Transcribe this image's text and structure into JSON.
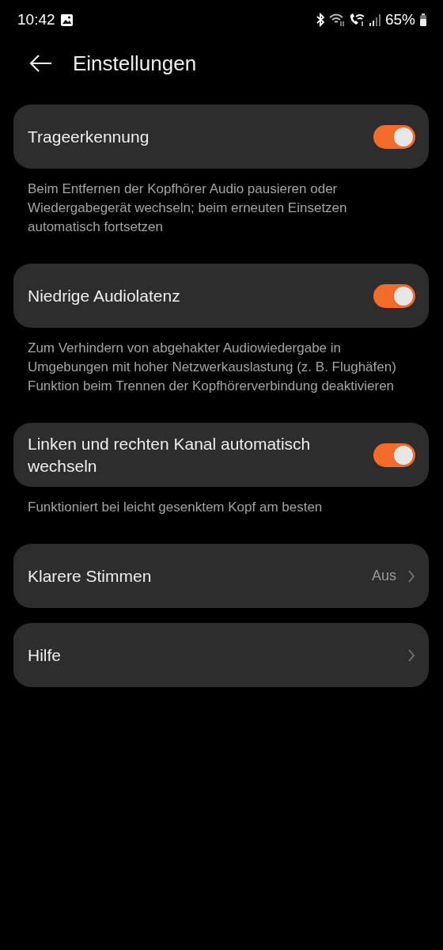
{
  "status_bar": {
    "time": "10:42",
    "battery": "65%"
  },
  "header": {
    "title": "Einstellungen"
  },
  "settings": [
    {
      "kind": "toggle",
      "label": "Trageerkennung",
      "on": true,
      "description": "Beim Entfernen der Kopfhörer Audio pausieren oder Wiedergabegerät wechseln; beim erneuten Einsetzen automatisch fortsetzen"
    },
    {
      "kind": "toggle",
      "label": "Niedrige Audiolatenz",
      "on": true,
      "description": "Zum Verhindern von abgehakter Audiowiedergabe in Umgebungen mit hoher Netzwerkauslastung (z. B. Flughäfen) Funktion beim Trennen der Kopfhörerverbindung deaktivieren"
    },
    {
      "kind": "toggle",
      "label": "Linken und rechten Kanal automatisch wechseln",
      "on": true,
      "description": "Funktioniert bei leicht gesenktem Kopf am besten"
    },
    {
      "kind": "link",
      "label": "Klarere Stimmen",
      "value": "Aus"
    },
    {
      "kind": "link",
      "label": "Hilfe"
    }
  ]
}
